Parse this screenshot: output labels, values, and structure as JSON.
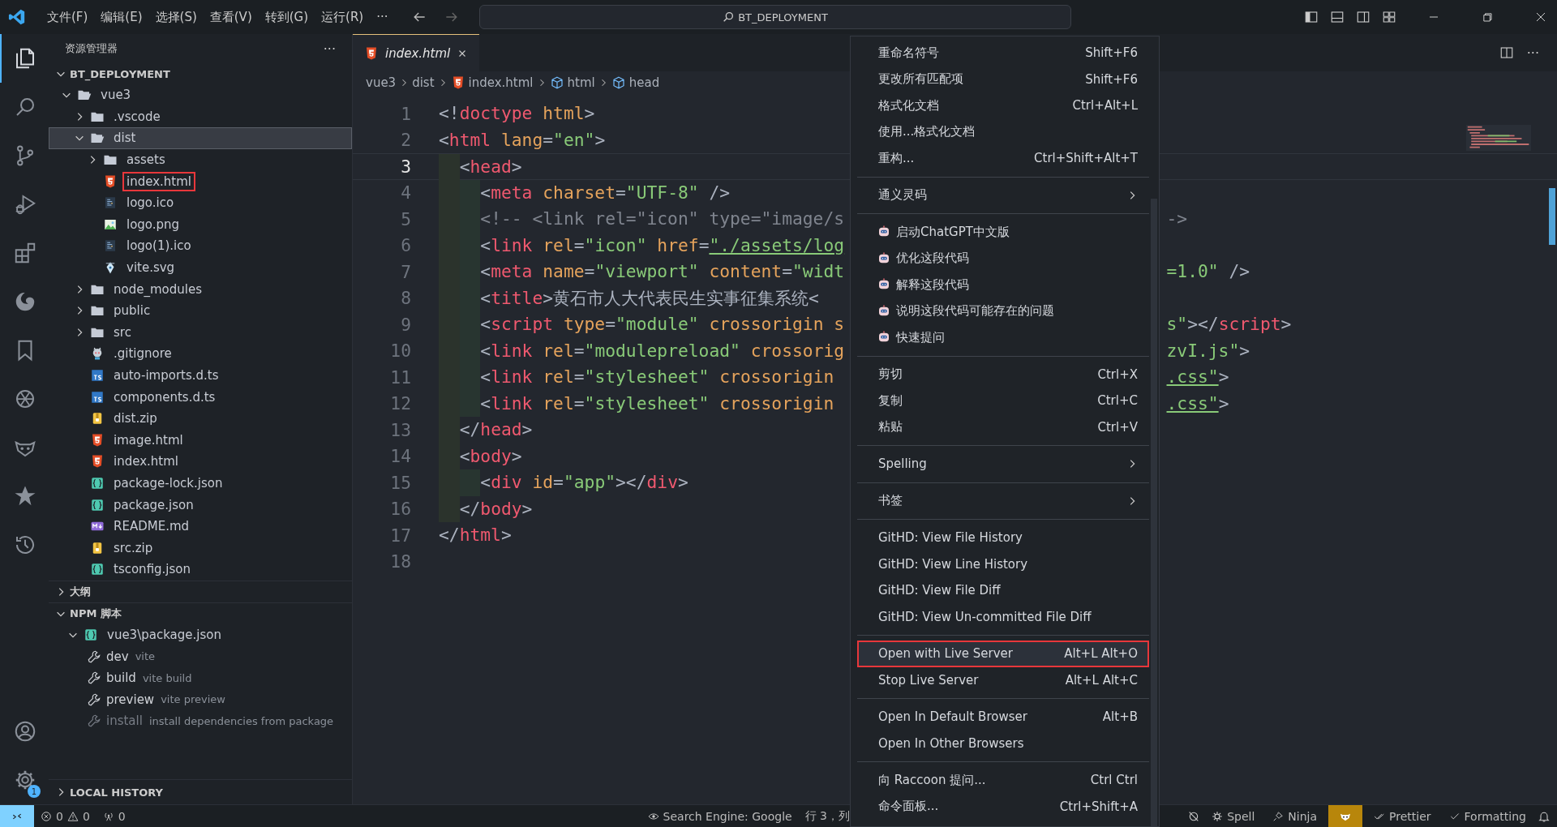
{
  "title_bar": {
    "menu": [
      "文件(F)",
      "编辑(E)",
      "选择(S)",
      "查看(V)",
      "转到(G)",
      "运行(R)",
      "···"
    ],
    "search": "BT_DEPLOYMENT"
  },
  "activity_bar": {
    "items": [
      {
        "selected": true
      },
      {
        "selected": false
      },
      {
        "selected": false
      },
      {
        "selected": false
      },
      {
        "selected": false
      },
      {
        "selected": false
      },
      {
        "selected": false
      },
      {
        "selected": false
      },
      {
        "selected": false
      },
      {
        "selected": false
      },
      {
        "selected": false
      }
    ],
    "settings_badge": "1"
  },
  "sidebar": {
    "title": "资源管理器",
    "more": "···",
    "root": "BT_DEPLOYMENT",
    "tree": [
      {
        "label": "vue3",
        "kind": "folder",
        "expanded": true,
        "selected": false,
        "outlined": false,
        "children": [
          {
            "label": ".vscode",
            "kind": "folder",
            "expanded": false,
            "selected": false,
            "outlined": false
          },
          {
            "label": "dist",
            "kind": "folder",
            "expanded": true,
            "selected": true,
            "outlined": false,
            "children": [
              {
                "label": "assets",
                "kind": "folder",
                "expanded": false,
                "selected": false,
                "outlined": false
              },
              {
                "label": "index.html",
                "kind": "html",
                "selected": false,
                "outlined": true
              },
              {
                "label": "logo.ico",
                "kind": "ico",
                "selected": false,
                "outlined": false
              },
              {
                "label": "logo.png",
                "kind": "image",
                "selected": false,
                "outlined": false
              },
              {
                "label": "logo(1).ico",
                "kind": "ico",
                "selected": false,
                "outlined": false
              },
              {
                "label": "vite.svg",
                "kind": "svg",
                "selected": false,
                "outlined": false
              }
            ]
          },
          {
            "label": "node_modules",
            "kind": "folder",
            "expanded": false,
            "selected": false,
            "outlined": false
          },
          {
            "label": "public",
            "kind": "folder",
            "expanded": false,
            "selected": false,
            "outlined": false
          },
          {
            "label": "src",
            "kind": "folder",
            "expanded": false,
            "selected": false,
            "outlined": false
          },
          {
            "label": ".gitignore",
            "kind": "git",
            "selected": false,
            "outlined": false
          },
          {
            "label": "auto-imports.d.ts",
            "kind": "ts",
            "selected": false,
            "outlined": false
          },
          {
            "label": "components.d.ts",
            "kind": "ts",
            "selected": false,
            "outlined": false
          },
          {
            "label": "dist.zip",
            "kind": "zip",
            "selected": false,
            "outlined": false
          },
          {
            "label": "image.html",
            "kind": "html",
            "selected": false,
            "outlined": false
          },
          {
            "label": "index.html",
            "kind": "html",
            "selected": false,
            "outlined": false
          },
          {
            "label": "package-lock.json",
            "kind": "json",
            "selected": false,
            "outlined": false
          },
          {
            "label": "package.json",
            "kind": "json",
            "selected": false,
            "outlined": false
          },
          {
            "label": "README.md",
            "kind": "md",
            "selected": false,
            "outlined": false
          },
          {
            "label": "src.zip",
            "kind": "zip",
            "selected": false,
            "outlined": false
          },
          {
            "label": "tsconfig.json",
            "kind": "json",
            "selected": false,
            "outlined": false
          }
        ]
      }
    ],
    "sections": [
      {
        "title": "大纲",
        "expanded": false
      },
      {
        "title": "NPM 脚本",
        "expanded": true
      }
    ],
    "npm": {
      "file": "vue3\\package.json",
      "scripts": [
        {
          "name": "dev",
          "command": "vite",
          "disabled": false
        },
        {
          "name": "build",
          "command": "vite build",
          "disabled": false
        },
        {
          "name": "preview",
          "command": "vite preview",
          "disabled": false
        },
        {
          "name": "install",
          "command": "install dependencies from package",
          "disabled": true
        }
      ]
    },
    "local_history": "LOCAL HISTORY"
  },
  "tab": {
    "label": "index.html",
    "selected": true
  },
  "breadcrumbs": [
    {
      "label": "vue3",
      "kind": "folder"
    },
    {
      "label": "dist",
      "kind": "folder"
    },
    {
      "label": "index.html",
      "kind": "html"
    },
    {
      "label": "html",
      "kind": "symbol"
    },
    {
      "label": "head",
      "kind": "symbol"
    }
  ],
  "code": [
    {
      "n": "1",
      "current": false,
      "text": "<!doctype html>"
    },
    {
      "n": "2",
      "current": false,
      "text": "<html lang=\"en\">"
    },
    {
      "n": "3",
      "current": true,
      "text": "  <head>"
    },
    {
      "n": "4",
      "current": false,
      "text": "    <meta charset=\"UTF-8\" />"
    },
    {
      "n": "5",
      "current": false,
      "text": "    <!-- <link rel=\"icon\" type=\"image/s",
      "right": "->"
    },
    {
      "n": "6",
      "current": false,
      "text": "    <link rel=\"icon\" href=\"./assets/log"
    },
    {
      "n": "7",
      "current": false,
      "text": "    <meta name=\"viewport\" content=\"widt",
      "right": "=1.0\" />"
    },
    {
      "n": "8",
      "current": false,
      "text": "    <title>黄石市人大代表民生实事征集系统<"
    },
    {
      "n": "9",
      "current": false,
      "text": "    <script type=\"module\" crossorigin s",
      "right": "s\"></script>"
    },
    {
      "n": "10",
      "current": false,
      "text": "    <link rel=\"modulepreload\" crossorig",
      "right": "zvI.js\">"
    },
    {
      "n": "11",
      "current": false,
      "text": "    <link rel=\"stylesheet\" crossorigin",
      "right": ".css\">"
    },
    {
      "n": "12",
      "current": false,
      "text": "    <link rel=\"stylesheet\" crossorigin",
      "right": ".css\">"
    },
    {
      "n": "13",
      "current": false,
      "text": "  </head>"
    },
    {
      "n": "14",
      "current": false,
      "text": "  <body>"
    },
    {
      "n": "15",
      "current": false,
      "text": "    <div id=\"app\"></div>"
    },
    {
      "n": "16",
      "current": false,
      "text": "  </body>"
    },
    {
      "n": "17",
      "current": false,
      "text": "</html>"
    },
    {
      "n": "18",
      "current": false
    }
  ],
  "context_menu": [
    [
      {
        "label": "重命名符号",
        "shortcut": "Shift+F6",
        "kind": "command",
        "selected": false
      },
      {
        "label": "更改所有匹配项",
        "shortcut": "Shift+F6",
        "kind": "command",
        "selected": false
      },
      {
        "label": "格式化文档",
        "shortcut": "Ctrl+Alt+L",
        "kind": "command",
        "selected": false
      },
      {
        "label": "使用...格式化文档",
        "kind": "command",
        "selected": false
      },
      {
        "label": "重构...",
        "shortcut": "Ctrl+Shift+Alt+T",
        "kind": "command",
        "selected": false
      }
    ],
    [
      {
        "label": "通义灵码",
        "kind": "submenu",
        "selected": false
      }
    ],
    [
      {
        "label": "启动ChatGPT中文版",
        "kind": "robot",
        "selected": false
      },
      {
        "label": "优化这段代码",
        "kind": "robot",
        "selected": false
      },
      {
        "label": "解释这段代码",
        "kind": "robot",
        "selected": false
      },
      {
        "label": "说明这段代码可能存在的问题",
        "kind": "robot",
        "selected": false
      },
      {
        "label": "快速提问",
        "kind": "robot",
        "selected": false
      }
    ],
    [
      {
        "label": "剪切",
        "shortcut": "Ctrl+X",
        "kind": "command",
        "selected": false
      },
      {
        "label": "复制",
        "shortcut": "Ctrl+C",
        "kind": "command",
        "selected": false
      },
      {
        "label": "粘贴",
        "shortcut": "Ctrl+V",
        "kind": "command",
        "selected": false
      }
    ],
    [
      {
        "label": "Spelling",
        "kind": "submenu",
        "selected": false
      }
    ],
    [
      {
        "label": "书签",
        "kind": "submenu",
        "selected": false
      }
    ],
    [
      {
        "label": "GitHD: View File History",
        "kind": "command",
        "selected": false
      },
      {
        "label": "GitHD: View Line History",
        "kind": "command",
        "selected": false
      },
      {
        "label": "GitHD: View File Diff",
        "kind": "command",
        "selected": false
      },
      {
        "label": "GitHD: View Un-committed File Diff",
        "kind": "command",
        "selected": false
      }
    ],
    [
      {
        "label": "Open with Live Server",
        "shortcut": "Alt+L Alt+O",
        "kind": "command",
        "selected": true
      },
      {
        "label": "Stop Live Server",
        "shortcut": "Alt+L Alt+C",
        "kind": "command",
        "selected": false
      }
    ],
    [
      {
        "label": "Open In Default Browser",
        "shortcut": "Alt+B",
        "kind": "command",
        "selected": false
      },
      {
        "label": "Open In Other Browsers",
        "kind": "command",
        "selected": false
      }
    ],
    [
      {
        "label": "向 Raccoon 提问...",
        "shortcut": "Ctrl Ctrl",
        "kind": "command",
        "selected": false
      },
      {
        "label": "命令面板...",
        "shortcut": "Ctrl+Shift+A",
        "kind": "command",
        "selected": false
      }
    ]
  ],
  "status_bar": {
    "errors": "0",
    "warnings": "0",
    "ports": "0",
    "search_engine": "Search Engine: Google",
    "position": "行 3，列",
    "spell": "Spell",
    "ninja": "Ninja",
    "prettier": "Prettier",
    "formatting": "Formatting"
  }
}
